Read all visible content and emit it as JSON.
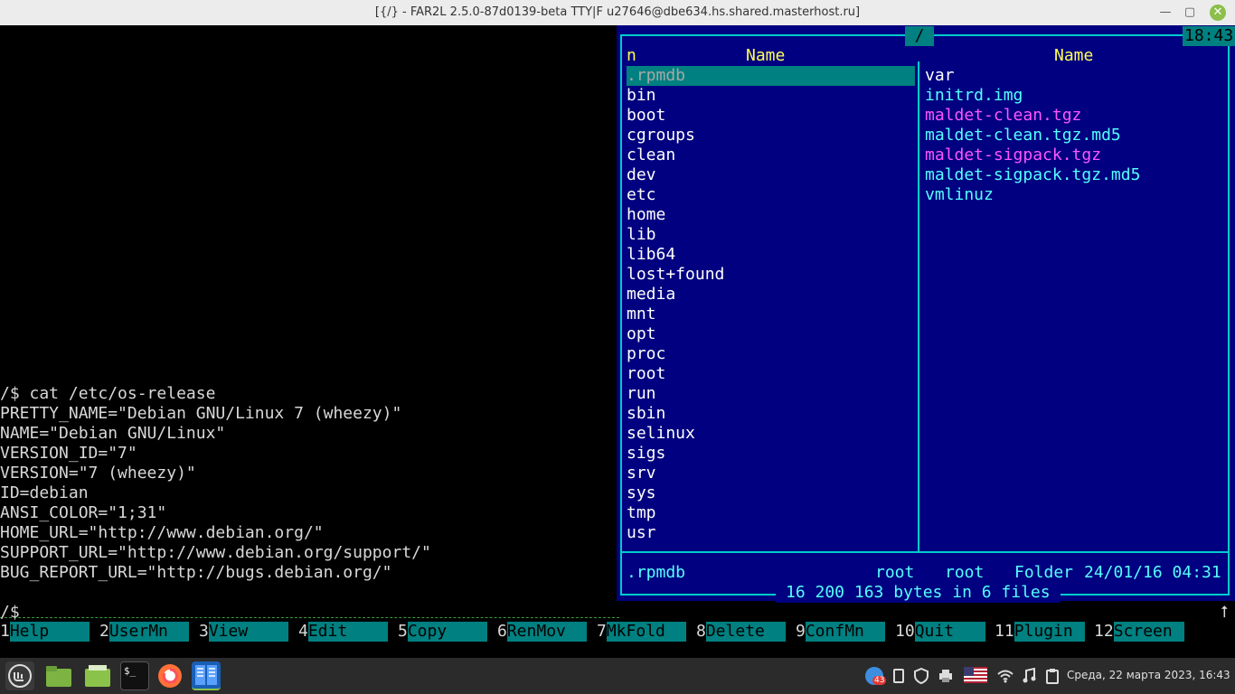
{
  "window": {
    "title": "[{/} - FAR2L 2.5.0-87d0139-beta TTY|F u27646@dbe634.hs.shared.masterhost.ru]",
    "minimize": "—",
    "maximize": "▢",
    "close": "✕"
  },
  "terminal": {
    "lines": [
      "/$ cat /etc/os-release",
      "PRETTY_NAME=\"Debian GNU/Linux 7 (wheezy)\"",
      "NAME=\"Debian GNU/Linux\"",
      "VERSION_ID=\"7\"",
      "VERSION=\"7 (wheezy)\"",
      "ID=debian",
      "ANSI_COLOR=\"1;31\"",
      "HOME_URL=\"http://www.debian.org/\"",
      "SUPPORT_URL=\"http://www.debian.org/support/\"",
      "BUG_REPORT_URL=\"http://bugs.debian.org/\""
    ],
    "prompt": "/$",
    "scroll_arrow": "⭡"
  },
  "panel": {
    "path": "/",
    "clock": "18:43",
    "left_col_sort": "n",
    "left_col_header": "Name",
    "right_col_header": "Name",
    "left_files": [
      ".rpmdb",
      "bin",
      "boot",
      "cgroups",
      "clean",
      "dev",
      "etc",
      "home",
      "lib",
      "lib64",
      "lost+found",
      "media",
      "mnt",
      "opt",
      "proc",
      "root",
      "run",
      "sbin",
      "selinux",
      "sigs",
      "srv",
      "sys",
      "tmp",
      "usr"
    ],
    "right_files": [
      {
        "name": "var",
        "color": "white"
      },
      {
        "name": "initrd.img",
        "color": "cyan"
      },
      {
        "name": "maldet-clean.tgz",
        "color": "magenta"
      },
      {
        "name": "maldet-clean.tgz.md5",
        "color": "cyan"
      },
      {
        "name": "maldet-sigpack.tgz",
        "color": "magenta"
      },
      {
        "name": "maldet-sigpack.tgz.md5",
        "color": "cyan"
      },
      {
        "name": "vmlinuz",
        "color": "cyan"
      }
    ],
    "status_name": ".rpmdb",
    "status_owner": "root",
    "status_group": "root",
    "status_type": "Folder",
    "status_date": "24/01/16 04:31",
    "summary": "16 200 163 bytes in 6 files"
  },
  "keybar": [
    {
      "num": "1",
      "label": "Help"
    },
    {
      "num": "2",
      "label": "UserMn"
    },
    {
      "num": "3",
      "label": "View"
    },
    {
      "num": "4",
      "label": "Edit"
    },
    {
      "num": "5",
      "label": "Copy"
    },
    {
      "num": "6",
      "label": "RenMov"
    },
    {
      "num": "7",
      "label": "MkFold"
    },
    {
      "num": "8",
      "label": "Delete"
    },
    {
      "num": "9",
      "label": "ConfMn"
    },
    {
      "num": "10",
      "label": "Quit"
    },
    {
      "num": "11",
      "label": "Plugin"
    },
    {
      "num": "12",
      "label": "Screen"
    }
  ],
  "taskbar": {
    "apps": [
      "mint-menu-icon",
      "folder-icon",
      "files-icon",
      "terminal-icon",
      "firefox-icon",
      "far2l-icon"
    ],
    "terminal_glyph": "$_",
    "badge": "43",
    "datetime": "Среда, 22 марта 2023, 16:43"
  },
  "colors": {
    "panel_bg": "#000080",
    "frame": "#00cccc",
    "cursor": "#008080"
  }
}
